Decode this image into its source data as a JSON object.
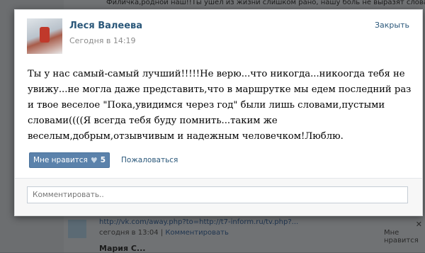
{
  "background": {
    "top_text": "Филичка,родной наш!!Ты ушел из жизни слишком рано, нашу боль не выразят слова. спи, родной, т",
    "row1": {
      "link": "http://vk.com/away.php?to=http://t7-inform.ru/tv.php?...",
      "time": "сегодня в 13:04",
      "separator": "|",
      "comment_link": "Комментировать",
      "likes": "Мне нравится",
      "close": "✕"
    },
    "row2": {
      "name": "Мария С..."
    }
  },
  "post": {
    "author": "Леся Валеева",
    "time": "Сегодня в 14:19",
    "close_label": "Закрыть",
    "text": "Ты у нас самый-самый лучший!!!!!Не верю...что никогда...никоогда тебя не увижу...не могла даже представить,что в маршрутке мы едем последний раз и твое веселое \"Пока,увидимся через год\" были лишь словами,пустыми словами((((Я всегда тебя буду помнить...таким же веселым,добрым,отзывчивым и надежным человечком!Люблю.",
    "like_label": "Мне нравится",
    "like_icon": "♥",
    "like_count": "5",
    "report_label": "Пожаловаться",
    "comment_placeholder": "Комментировать.."
  },
  "colors": {
    "link": "#2b587a",
    "like_button": "#5b82ab"
  }
}
